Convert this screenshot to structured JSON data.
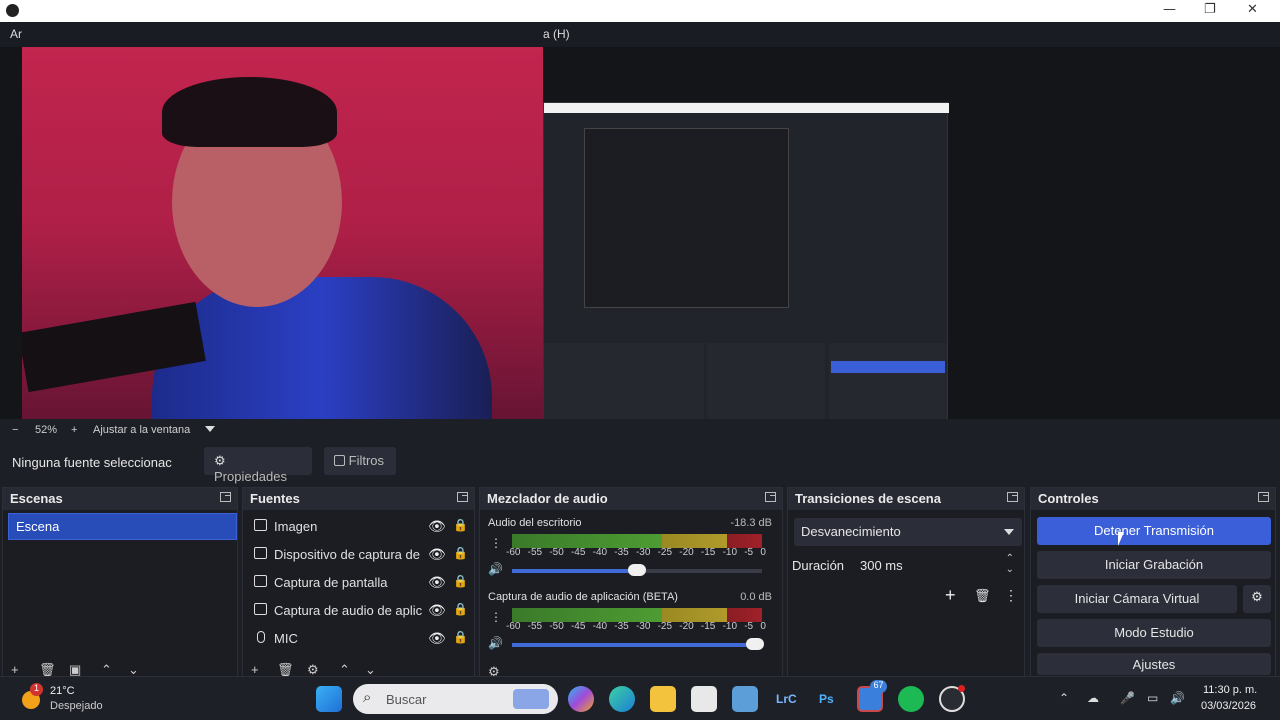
{
  "window": {
    "menu_left": "Ar",
    "menu_right": "a (H)",
    "minimize": "—",
    "maximize": "❐",
    "close": "✕"
  },
  "zoom": {
    "minus": "−",
    "value": "52%",
    "plus": "+",
    "fit": "Ajustar a la ventana"
  },
  "sourcebar": {
    "no_source": "Ninguna fuente seleccionac",
    "properties": "Propiedades",
    "filters": "Filtros"
  },
  "scenes": {
    "title": "Escenas",
    "items": [
      "Escena"
    ]
  },
  "sources": {
    "title": "Fuentes",
    "items": [
      {
        "label": "Imagen",
        "icon": "image-icon"
      },
      {
        "label": "Dispositivo de captura de v",
        "icon": "camera-icon"
      },
      {
        "label": "Captura de pantalla",
        "icon": "monitor-icon"
      },
      {
        "label": "Captura de audio de aplica",
        "icon": "app-audio-icon"
      },
      {
        "label": "MIC",
        "icon": "mic-icon"
      }
    ]
  },
  "mixer": {
    "title": "Mezclador de audio",
    "ticks": [
      "-60",
      "-55",
      "-50",
      "-45",
      "-40",
      "-35",
      "-30",
      "-25",
      "-20",
      "-15",
      "-10",
      "-5",
      "0"
    ],
    "channels": [
      {
        "name": "Audio del escritorio",
        "db": "-18.3 dB",
        "level": 0.5
      },
      {
        "name": "Captura de audio de aplicación (BETA)",
        "db": "0.0 dB",
        "level": 0.97
      }
    ]
  },
  "transitions": {
    "title": "Transiciones de escena",
    "selected": "Desvanecimiento",
    "duration_label": "Duración",
    "duration_value": "300 ms"
  },
  "controls": {
    "title": "Controles",
    "stop_stream": "Detener Transmisión",
    "start_recording": "Iniciar Grabación",
    "start_virtual_cam": "Iniciar Cámara Virtual",
    "studio_mode": "Modo Estudio",
    "settings": "Ajustes"
  },
  "taskbar": {
    "weather_temp": "21°C",
    "weather_desc": "Despejado",
    "weather_badge": "1",
    "search": "Buscar",
    "app_badge": "67",
    "time": "11:30 p. m.",
    "date": "03/03/2026"
  },
  "colors": {
    "accent": "#3a5fd9",
    "selected_scene": "#284cb8"
  }
}
